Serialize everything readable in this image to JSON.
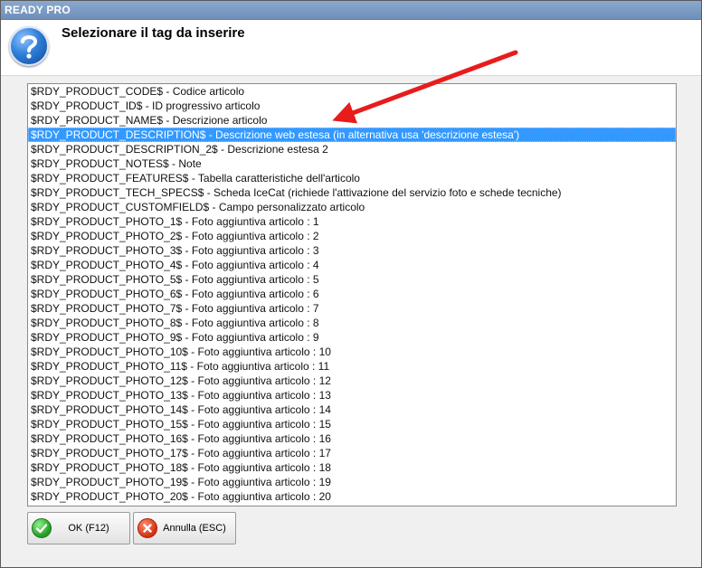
{
  "window": {
    "title": "READY PRO"
  },
  "header": {
    "prompt": "Selezionare il tag da inserire",
    "icon": "question-icon"
  },
  "list": {
    "selected_index": 3,
    "items": [
      "$RDY_PRODUCT_CODE$ - Codice articolo",
      "$RDY_PRODUCT_ID$ - ID progressivo articolo",
      "$RDY_PRODUCT_NAME$ - Descrizione articolo",
      "$RDY_PRODUCT_DESCRIPTION$ - Descrizione web estesa (in alternativa usa 'descrizione estesa')",
      "$RDY_PRODUCT_DESCRIPTION_2$ - Descrizione estesa 2",
      "$RDY_PRODUCT_NOTES$ - Note",
      "$RDY_PRODUCT_FEATURES$ - Tabella caratteristiche dell'articolo",
      "$RDY_PRODUCT_TECH_SPECS$ - Scheda IceCat (richiede l'attivazione del servizio foto e schede tecniche)",
      "$RDY_PRODUCT_CUSTOMFIELD$ - Campo personalizzato articolo",
      "$RDY_PRODUCT_PHOTO_1$ - Foto aggiuntiva articolo : 1",
      "$RDY_PRODUCT_PHOTO_2$ - Foto aggiuntiva articolo : 2",
      "$RDY_PRODUCT_PHOTO_3$ - Foto aggiuntiva articolo : 3",
      "$RDY_PRODUCT_PHOTO_4$ - Foto aggiuntiva articolo : 4",
      "$RDY_PRODUCT_PHOTO_5$ - Foto aggiuntiva articolo : 5",
      "$RDY_PRODUCT_PHOTO_6$ - Foto aggiuntiva articolo : 6",
      "$RDY_PRODUCT_PHOTO_7$ - Foto aggiuntiva articolo : 7",
      "$RDY_PRODUCT_PHOTO_8$ - Foto aggiuntiva articolo : 8",
      "$RDY_PRODUCT_PHOTO_9$ - Foto aggiuntiva articolo : 9",
      "$RDY_PRODUCT_PHOTO_10$ - Foto aggiuntiva articolo : 10",
      "$RDY_PRODUCT_PHOTO_11$ - Foto aggiuntiva articolo : 11",
      "$RDY_PRODUCT_PHOTO_12$ - Foto aggiuntiva articolo : 12",
      "$RDY_PRODUCT_PHOTO_13$ - Foto aggiuntiva articolo : 13",
      "$RDY_PRODUCT_PHOTO_14$ - Foto aggiuntiva articolo : 14",
      "$RDY_PRODUCT_PHOTO_15$ - Foto aggiuntiva articolo : 15",
      "$RDY_PRODUCT_PHOTO_16$ - Foto aggiuntiva articolo : 16",
      "$RDY_PRODUCT_PHOTO_17$ - Foto aggiuntiva articolo : 17",
      "$RDY_PRODUCT_PHOTO_18$ - Foto aggiuntiva articolo : 18",
      "$RDY_PRODUCT_PHOTO_19$ - Foto aggiuntiva articolo : 19",
      "$RDY_PRODUCT_PHOTO_20$ - Foto aggiuntiva articolo : 20"
    ]
  },
  "buttons": {
    "ok_label": "OK (F12)",
    "ok_icon": "checkmark-icon",
    "cancel_label": "Annulla (ESC)",
    "cancel_icon": "cancel-icon"
  },
  "colors": {
    "selection": "#3399ff",
    "annotation_arrow": "#e81c1c",
    "titlebar": "#7a98c4"
  }
}
